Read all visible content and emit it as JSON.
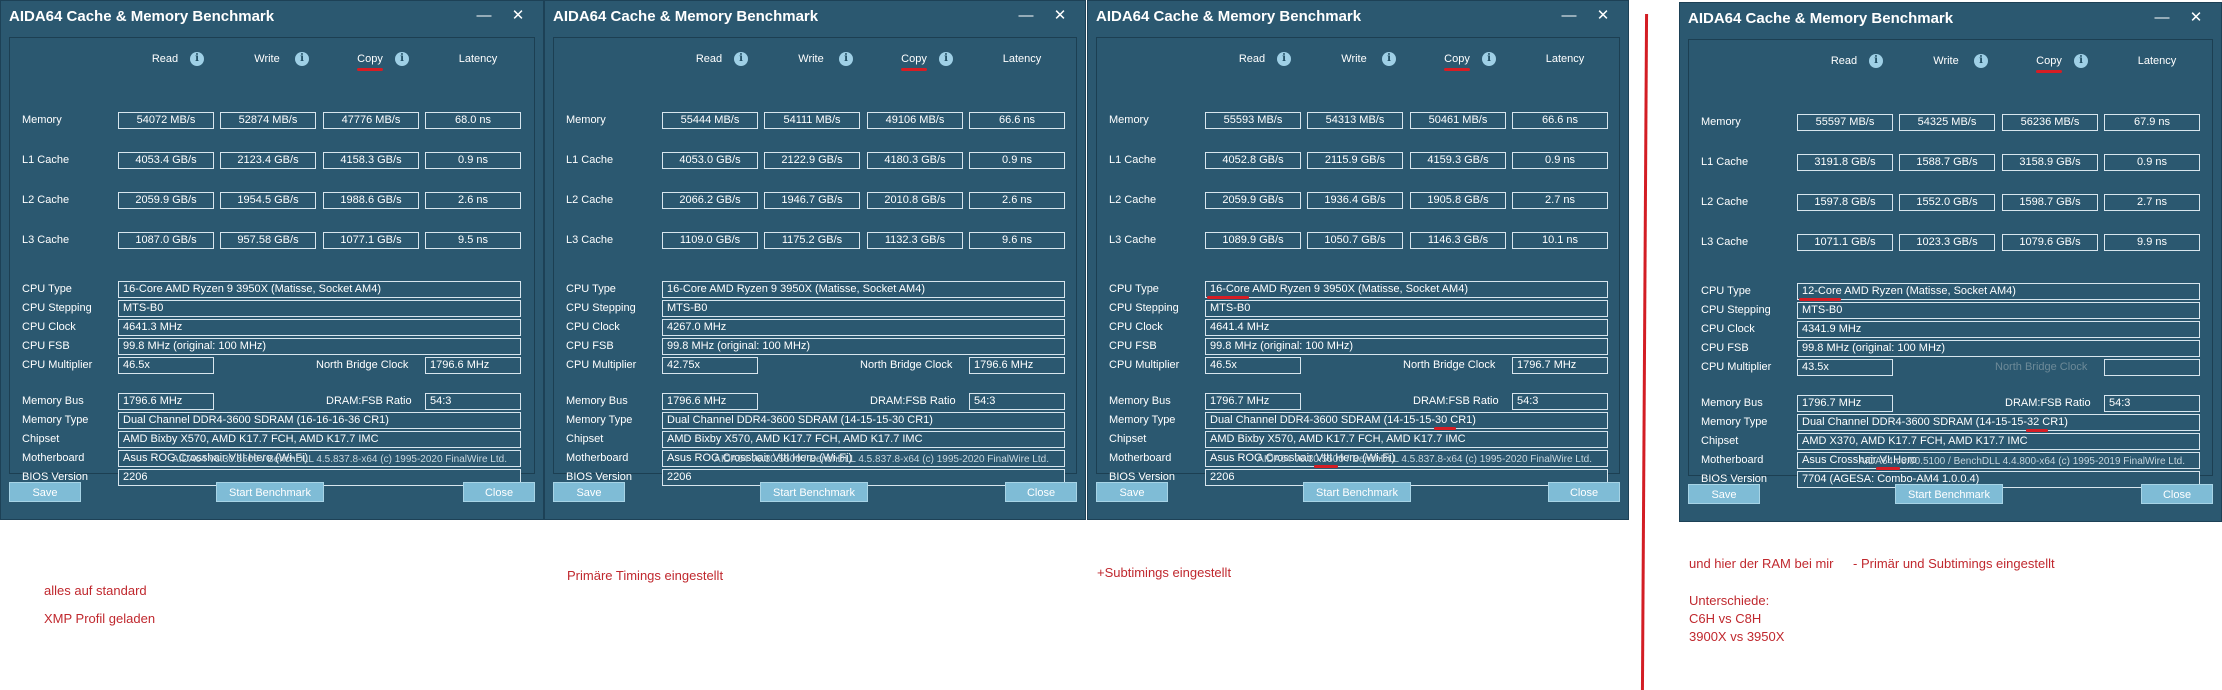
{
  "windows": [
    {
      "title": "AIDA64 Cache & Memory Benchmark",
      "headers": {
        "read": "Read",
        "write": "Write",
        "copy": "Copy",
        "latency": "Latency"
      },
      "rows": [
        {
          "label": "Memory",
          "read": "54072 MB/s",
          "write": "52874 MB/s",
          "copy": "47776 MB/s",
          "latency": "68.0 ns"
        },
        {
          "label": "L1 Cache",
          "read": "4053.4 GB/s",
          "write": "2123.4 GB/s",
          "copy": "4158.3 GB/s",
          "latency": "0.9 ns"
        },
        {
          "label": "L2 Cache",
          "read": "2059.9 GB/s",
          "write": "1954.5 GB/s",
          "copy": "1988.6 GB/s",
          "latency": "2.6 ns"
        },
        {
          "label": "L3 Cache",
          "read": "1087.0 GB/s",
          "write": "957.58 GB/s",
          "copy": "1077.1 GB/s",
          "latency": "9.5 ns"
        }
      ],
      "cpu_type": {
        "label": "CPU Type",
        "value": "16-Core AMD Ryzen 9 3950X  (Matisse, Socket AM4)"
      },
      "cpu_stepping": {
        "label": "CPU Stepping",
        "value": "MTS-B0"
      },
      "cpu_clock": {
        "label": "CPU Clock",
        "value": "4641.3 MHz"
      },
      "cpu_fsb": {
        "label": "CPU FSB",
        "value": "99.8 MHz  (original: 100 MHz)"
      },
      "cpu_multiplier": {
        "label": "CPU Multiplier",
        "value": "46.5x"
      },
      "nb_clock": {
        "label": "North Bridge Clock",
        "value": "1796.6 MHz"
      },
      "memory_bus": {
        "label": "Memory Bus",
        "value": "1796.6 MHz"
      },
      "dram_ratio": {
        "label": "DRAM:FSB Ratio",
        "value": "54:3"
      },
      "memory_type": {
        "label": "Memory Type",
        "value": "Dual Channel DDR4-3600 SDRAM  (16-16-16-36 CR1)"
      },
      "chipset": {
        "label": "Chipset",
        "value": "AMD Bixby X570, AMD K17.7 FCH, AMD K17.7 IMC"
      },
      "motherboard": {
        "label": "Motherboard",
        "value": "Asus ROG Crosshair VIII Hero (Wi-Fi)"
      },
      "bios": {
        "label": "BIOS Version",
        "value": "2206"
      },
      "footer": "AIDA64 v6.30.5500 / BenchDLL 4.5.837.8-x64  (c) 1995-2020 FinalWire Ltd.",
      "buttons": {
        "save": "Save",
        "start": "Start Benchmark",
        "close": "Close"
      }
    },
    {
      "title": "AIDA64 Cache & Memory Benchmark",
      "headers": {
        "read": "Read",
        "write": "Write",
        "copy": "Copy",
        "latency": "Latency"
      },
      "rows": [
        {
          "label": "Memory",
          "read": "55444 MB/s",
          "write": "54111 MB/s",
          "copy": "49106 MB/s",
          "latency": "66.6 ns"
        },
        {
          "label": "L1 Cache",
          "read": "4053.0 GB/s",
          "write": "2122.9 GB/s",
          "copy": "4180.3 GB/s",
          "latency": "0.9 ns"
        },
        {
          "label": "L2 Cache",
          "read": "2066.2 GB/s",
          "write": "1946.7 GB/s",
          "copy": "2010.8 GB/s",
          "latency": "2.6 ns"
        },
        {
          "label": "L3 Cache",
          "read": "1109.0 GB/s",
          "write": "1175.2 GB/s",
          "copy": "1132.3 GB/s",
          "latency": "9.6 ns"
        }
      ],
      "cpu_type": {
        "label": "CPU Type",
        "value": "16-Core AMD Ryzen 9 3950X  (Matisse, Socket AM4)"
      },
      "cpu_stepping": {
        "label": "CPU Stepping",
        "value": "MTS-B0"
      },
      "cpu_clock": {
        "label": "CPU Clock",
        "value": "4267.0 MHz"
      },
      "cpu_fsb": {
        "label": "CPU FSB",
        "value": "99.8 MHz  (original: 100 MHz)"
      },
      "cpu_multiplier": {
        "label": "CPU Multiplier",
        "value": "42.75x"
      },
      "nb_clock": {
        "label": "North Bridge Clock",
        "value": "1796.6 MHz"
      },
      "memory_bus": {
        "label": "Memory Bus",
        "value": "1796.6 MHz"
      },
      "dram_ratio": {
        "label": "DRAM:FSB Ratio",
        "value": "54:3"
      },
      "memory_type": {
        "label": "Memory Type",
        "value": "Dual Channel DDR4-3600 SDRAM  (14-15-15-30 CR1)"
      },
      "chipset": {
        "label": "Chipset",
        "value": "AMD Bixby X570, AMD K17.7 FCH, AMD K17.7 IMC"
      },
      "motherboard": {
        "label": "Motherboard",
        "value": "Asus ROG Crosshair VIII Hero (Wi-Fi)"
      },
      "bios": {
        "label": "BIOS Version",
        "value": "2206"
      },
      "footer": "AIDA64 v6.30.5500 / BenchDLL 4.5.837.8-x64  (c) 1995-2020 FinalWire Ltd.",
      "buttons": {
        "save": "Save",
        "start": "Start Benchmark",
        "close": "Close"
      }
    },
    {
      "title": "AIDA64 Cache & Memory Benchmark",
      "headers": {
        "read": "Read",
        "write": "Write",
        "copy": "Copy",
        "latency": "Latency"
      },
      "rows": [
        {
          "label": "Memory",
          "read": "55593 MB/s",
          "write": "54313 MB/s",
          "copy": "50461 MB/s",
          "latency": "66.6 ns"
        },
        {
          "label": "L1 Cache",
          "read": "4052.8 GB/s",
          "write": "2115.9 GB/s",
          "copy": "4159.3 GB/s",
          "latency": "0.9 ns"
        },
        {
          "label": "L2 Cache",
          "read": "2059.9 GB/s",
          "write": "1936.4 GB/s",
          "copy": "1905.8 GB/s",
          "latency": "2.7 ns"
        },
        {
          "label": "L3 Cache",
          "read": "1089.9 GB/s",
          "write": "1050.7 GB/s",
          "copy": "1146.3 GB/s",
          "latency": "10.1 ns"
        }
      ],
      "cpu_type": {
        "label": "CPU Type",
        "value": "16-Core AMD Ryzen 9 3950X  (Matisse, Socket AM4)"
      },
      "cpu_stepping": {
        "label": "CPU Stepping",
        "value": "MTS-B0"
      },
      "cpu_clock": {
        "label": "CPU Clock",
        "value": "4641.4 MHz"
      },
      "cpu_fsb": {
        "label": "CPU FSB",
        "value": "99.8 MHz  (original: 100 MHz)"
      },
      "cpu_multiplier": {
        "label": "CPU Multiplier",
        "value": "46.5x"
      },
      "nb_clock": {
        "label": "North Bridge Clock",
        "value": "1796.7 MHz"
      },
      "memory_bus": {
        "label": "Memory Bus",
        "value": "1796.7 MHz"
      },
      "dram_ratio": {
        "label": "DRAM:FSB Ratio",
        "value": "54:3"
      },
      "memory_type": {
        "label": "Memory Type",
        "value": "Dual Channel DDR4-3600 SDRAM  (14-15-15-30 CR1)"
      },
      "chipset": {
        "label": "Chipset",
        "value": "AMD Bixby X570, AMD K17.7 FCH, AMD K17.7 IMC"
      },
      "motherboard": {
        "label": "Motherboard",
        "value": "Asus ROG Crosshair VIII Hero (Wi-Fi)"
      },
      "bios": {
        "label": "BIOS Version",
        "value": "2206"
      },
      "footer": "AIDA64 v6.30.5500 / BenchDLL 4.5.837.8-x64  (c) 1995-2020 FinalWire Ltd.",
      "buttons": {
        "save": "Save",
        "start": "Start Benchmark",
        "close": "Close"
      }
    },
    {
      "title": "AIDA64 Cache & Memory Benchmark",
      "headers": {
        "read": "Read",
        "write": "Write",
        "copy": "Copy",
        "latency": "Latency"
      },
      "rows": [
        {
          "label": "Memory",
          "read": "55597 MB/s",
          "write": "54325 MB/s",
          "copy": "56236 MB/s",
          "latency": "67.9 ns"
        },
        {
          "label": "L1 Cache",
          "read": "3191.8 GB/s",
          "write": "1588.7 GB/s",
          "copy": "3158.9 GB/s",
          "latency": "0.9 ns"
        },
        {
          "label": "L2 Cache",
          "read": "1597.8 GB/s",
          "write": "1552.0 GB/s",
          "copy": "1598.7 GB/s",
          "latency": "2.7 ns"
        },
        {
          "label": "L3 Cache",
          "read": "1071.1 GB/s",
          "write": "1023.3 GB/s",
          "copy": "1079.6 GB/s",
          "latency": "9.9 ns"
        }
      ],
      "cpu_type": {
        "label": "CPU Type",
        "value": "12-Core AMD Ryzen  (Matisse, Socket AM4)"
      },
      "cpu_stepping": {
        "label": "CPU Stepping",
        "value": "MTS-B0"
      },
      "cpu_clock": {
        "label": "CPU Clock",
        "value": "4341.9 MHz"
      },
      "cpu_fsb": {
        "label": "CPU FSB",
        "value": "99.8 MHz  (original: 100 MHz)"
      },
      "cpu_multiplier": {
        "label": "CPU Multiplier",
        "value": "43.5x"
      },
      "nb_clock": {
        "label": "North Bridge Clock",
        "value": ""
      },
      "memory_bus": {
        "label": "Memory Bus",
        "value": "1796.7 MHz"
      },
      "dram_ratio": {
        "label": "DRAM:FSB Ratio",
        "value": "54:3"
      },
      "memory_type": {
        "label": "Memory Type",
        "value": "Dual Channel DDR4-3600 SDRAM  (14-15-15-32 CR1)"
      },
      "chipset": {
        "label": "Chipset",
        "value": "AMD X370, AMD K17.7 FCH, AMD K17.7 IMC"
      },
      "motherboard": {
        "label": "Motherboard",
        "value": "Asus Crosshair VI Hero"
      },
      "bios": {
        "label": "BIOS Version",
        "value": "7704  (AGESA: Combo-AM4 1.0.0.4)"
      },
      "footer": "AIDA64 v6.00.5100 / BenchDLL 4.4.800-x64  (c) 1995-2019 FinalWire Ltd.",
      "buttons": {
        "save": "Save",
        "start": "Start Benchmark",
        "close": "Close"
      }
    }
  ],
  "window_buttons": {
    "minimize": "—",
    "close": "✕"
  },
  "info_glyph": "i",
  "annotations": {
    "note1_line1": "alles auf standard",
    "note1_line2": "XMP Profil geladen",
    "note2": "Primäre Timings eingestellt",
    "note3": "+Subtimings eingestellt",
    "note4_a": "und hier der RAM bei mir",
    "note4_b": "- Primär und Subtimings eingestellt",
    "note4_line2": "Unterschiede:",
    "note4_line3": "C6H vs C8H",
    "note4_line4": "3900X vs 3950X"
  },
  "colors": {
    "window_bg": "#2b5870",
    "button_bg": "#7fbcd6",
    "annotation_red": "#c0282e"
  }
}
